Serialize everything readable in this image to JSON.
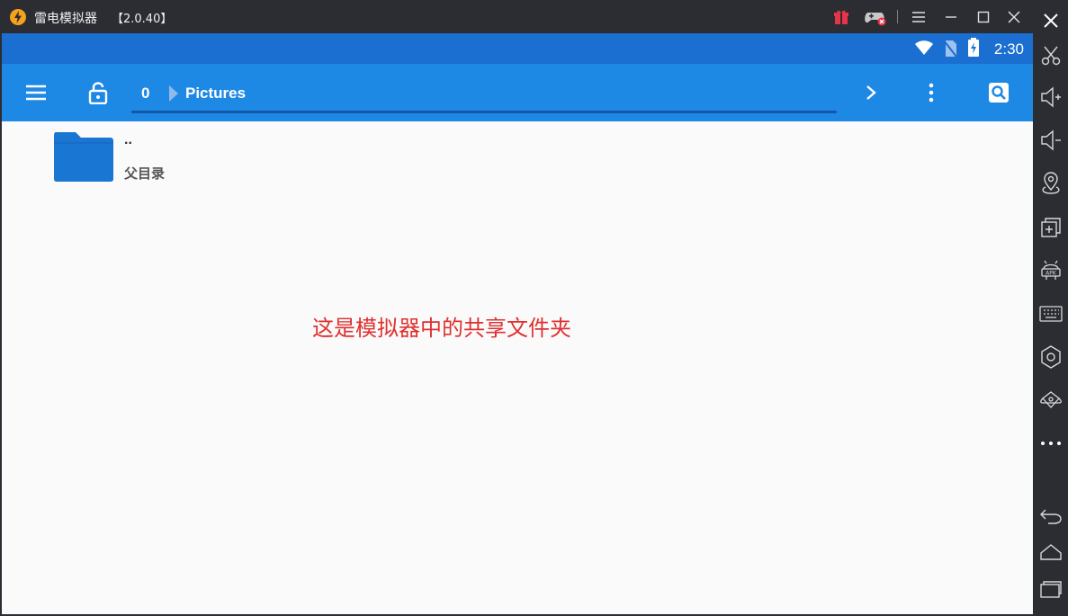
{
  "window": {
    "title": "雷电模拟器",
    "version": "【2.0.40】"
  },
  "status_bar": {
    "time": "2:30"
  },
  "app_bar": {
    "breadcrumb_index": "0",
    "breadcrumb_folder": "Pictures"
  },
  "files": [
    {
      "name": "..",
      "description": "父目录"
    }
  ],
  "annotation": "这是模拟器中的共享文件夹",
  "colors": {
    "status_bar": "#1a6fd0",
    "app_bar": "#1e88e5",
    "folder": "#1976d2",
    "annotation": "#e03030",
    "chrome": "#2b2d33"
  },
  "icons": {
    "titlebar": [
      "gift-icon",
      "gamepad-icon",
      "menu-icon",
      "minimize-icon",
      "maximize-icon",
      "close-icon"
    ],
    "appbar": [
      "hamburger-icon",
      "lock-icon",
      "chevron-right-icon",
      "more-vert-icon",
      "search-icon"
    ],
    "sidebar": [
      "close-icon",
      "scissors-icon",
      "volume-up-icon",
      "volume-down-icon",
      "location-icon",
      "multi-instance-icon",
      "apk-install-icon",
      "keyboard-icon",
      "settings-icon",
      "shake-icon",
      "more-horizontal-icon",
      "back-icon",
      "home-icon",
      "recent-apps-icon"
    ]
  }
}
